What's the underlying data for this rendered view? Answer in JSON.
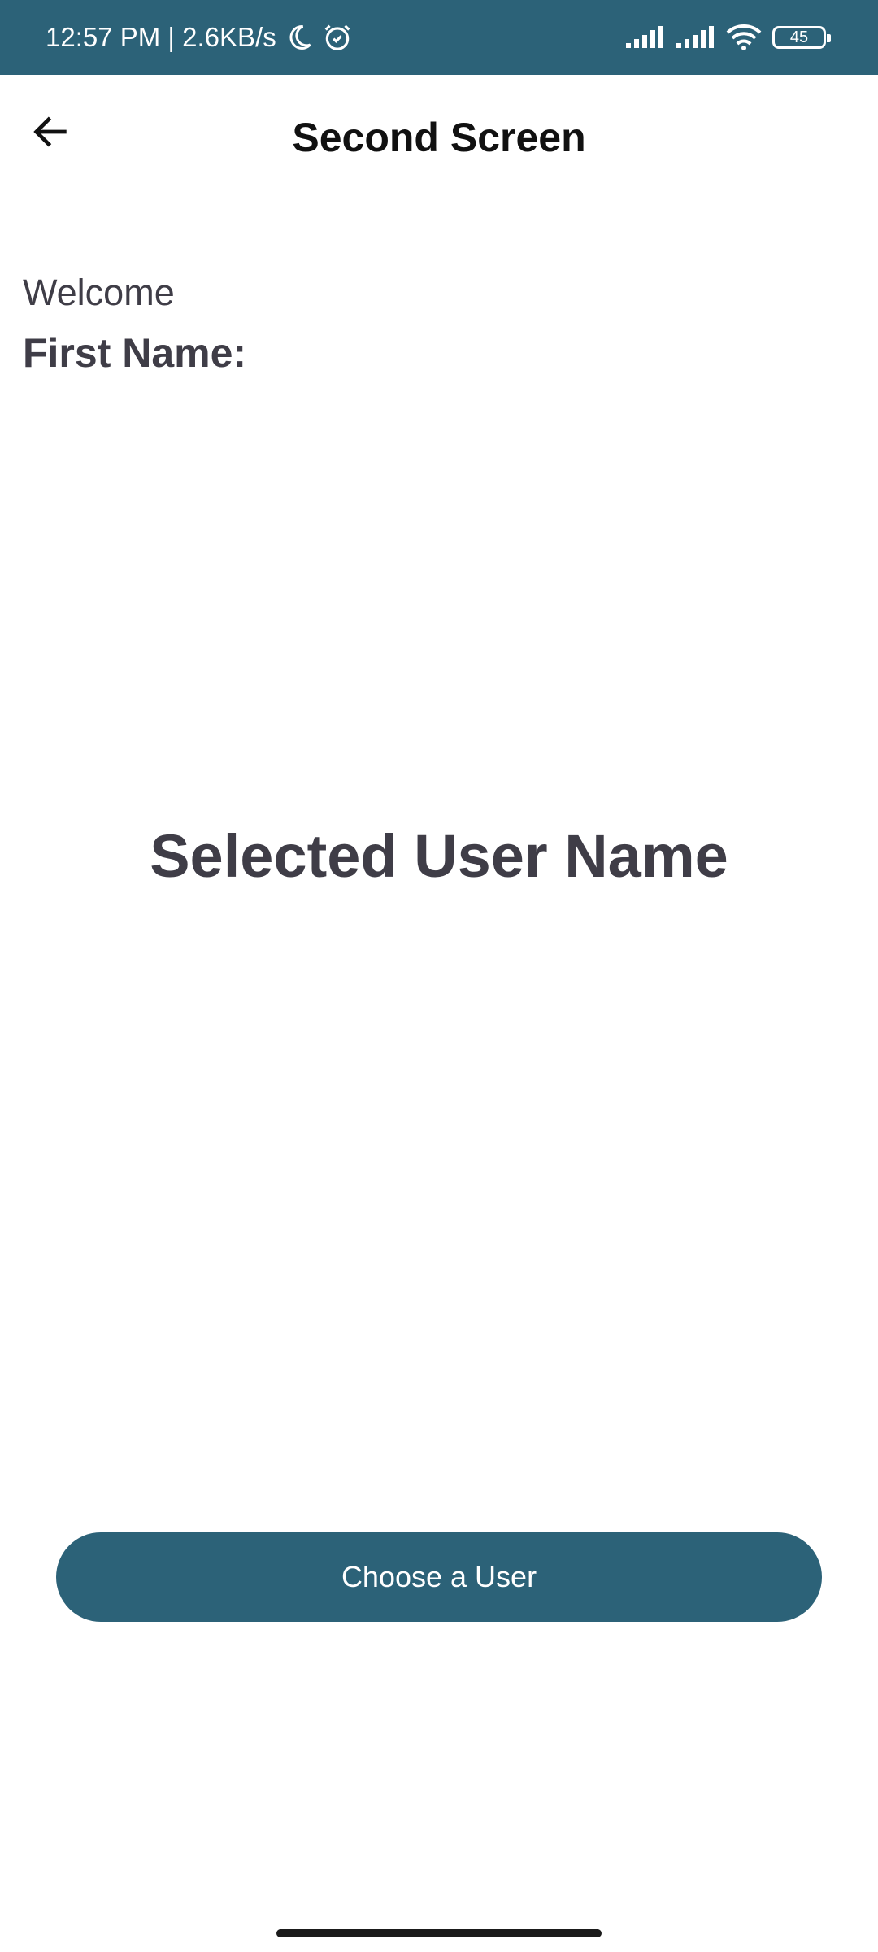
{
  "status_bar": {
    "time_speed": "12:57 PM | 2.6KB/s",
    "battery_level": "45",
    "icons": [
      "moon-icon",
      "alarm-icon",
      "signal-icon",
      "signal-icon",
      "wifi-icon",
      "battery-icon"
    ],
    "background_color": "#2c6278"
  },
  "app_bar": {
    "title": "Second Screen",
    "back_icon": "arrow-left-icon"
  },
  "content": {
    "welcome": "Welcome",
    "first_name_label": "First Name:",
    "selected_user": "Selected User Name"
  },
  "actions": {
    "choose_user_label": "Choose a User",
    "button_color": "#2c6278"
  }
}
